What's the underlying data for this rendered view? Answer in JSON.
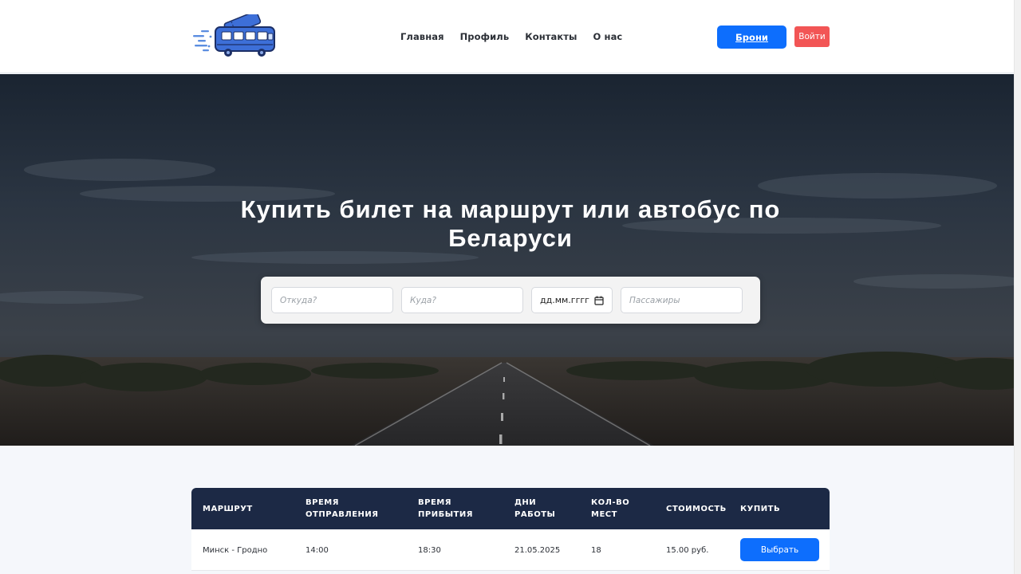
{
  "header": {
    "logo_icon": "bus-logo-icon",
    "nav": [
      {
        "label": "Главная"
      },
      {
        "label": "Профиль"
      },
      {
        "label": "Контакты"
      },
      {
        "label": "О нас"
      }
    ],
    "bookings_label": "Брони",
    "login_label": "Войти"
  },
  "colors": {
    "primary": "#0d6efd",
    "danger": "#f25555",
    "table_header": "#1c2945"
  },
  "hero": {
    "title": "Купить билет на маршрут или автобус по Беларуси",
    "search": {
      "from_placeholder": "Откуда?",
      "to_placeholder": "Куда?",
      "date_placeholder": "дд.мм.гггг",
      "date_icon": "calendar-icon",
      "passengers_placeholder": "Пассажиры"
    }
  },
  "table": {
    "headers": [
      "Маршрут",
      "Время отправления",
      "Время прибытия",
      "Дни работы",
      "Кол-во мест",
      "Стоимость",
      "Купить"
    ],
    "rows": [
      {
        "route": "Минск - Гродно",
        "departure": "14:00",
        "arrival": "18:30",
        "days": "21.05.2025",
        "seats": "18",
        "price": "15.00 руб.",
        "action": "Выбрать"
      }
    ]
  }
}
